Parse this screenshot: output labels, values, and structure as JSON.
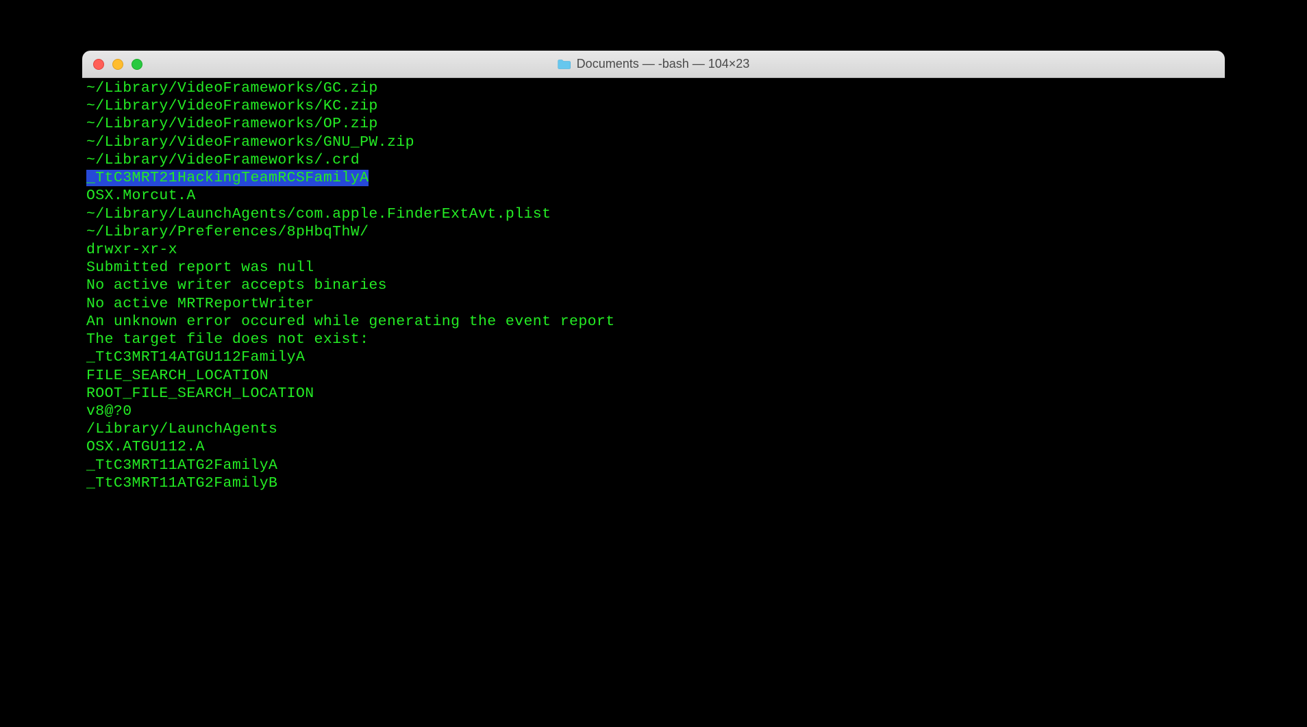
{
  "window": {
    "title": "Documents — -bash — 104×23",
    "folder_color": "#5ac8fa"
  },
  "terminal": {
    "text_color": "#24ec24",
    "selection_color": "#2649d8",
    "lines": [
      {
        "text": "~/Library/VideoFrameworks/GC.zip",
        "selected": false
      },
      {
        "text": "~/Library/VideoFrameworks/KC.zip",
        "selected": false
      },
      {
        "text": "~/Library/VideoFrameworks/OP.zip",
        "selected": false
      },
      {
        "text": "~/Library/VideoFrameworks/GNU_PW.zip",
        "selected": false
      },
      {
        "text": "~/Library/VideoFrameworks/.crd",
        "selected": false
      },
      {
        "text": "_TtC3MRT21HackingTeamRCSFamilyA",
        "selected": true
      },
      {
        "text": "OSX.Morcut.A",
        "selected": false
      },
      {
        "text": "~/Library/LaunchAgents/com.apple.FinderExtAvt.plist",
        "selected": false
      },
      {
        "text": "~/Library/Preferences/8pHbqThW/",
        "selected": false
      },
      {
        "text": "drwxr-xr-x",
        "selected": false
      },
      {
        "text": "Submitted report was null",
        "selected": false
      },
      {
        "text": "No active writer accepts binaries",
        "selected": false
      },
      {
        "text": "No active MRTReportWriter",
        "selected": false
      },
      {
        "text": "An unknown error occured while generating the event report",
        "selected": false
      },
      {
        "text": "The target file does not exist:",
        "selected": false
      },
      {
        "text": "_TtC3MRT14ATGU112FamilyA",
        "selected": false
      },
      {
        "text": "FILE_SEARCH_LOCATION",
        "selected": false
      },
      {
        "text": "ROOT_FILE_SEARCH_LOCATION",
        "selected": false
      },
      {
        "text": "v8@?0",
        "selected": false
      },
      {
        "text": "/Library/LaunchAgents",
        "selected": false
      },
      {
        "text": "OSX.ATGU112.A",
        "selected": false
      },
      {
        "text": "_TtC3MRT11ATG2FamilyA",
        "selected": false
      },
      {
        "text": "_TtC3MRT11ATG2FamilyB",
        "selected": false
      }
    ]
  }
}
